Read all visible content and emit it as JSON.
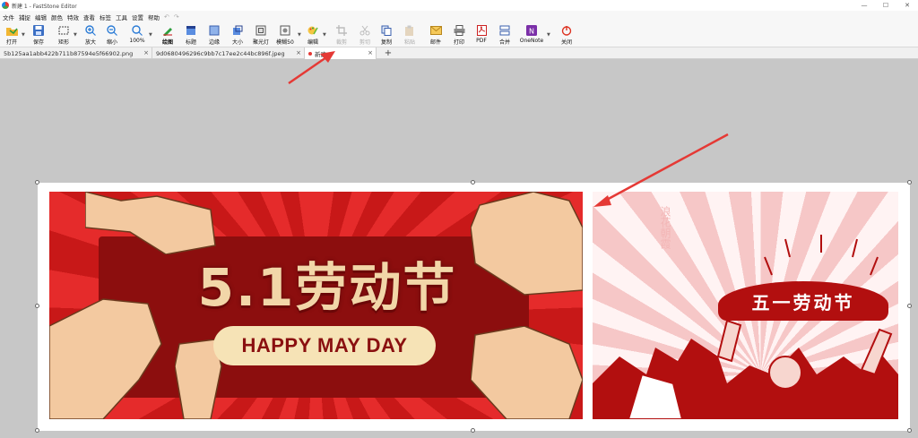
{
  "window": {
    "title": "新建 1 - FastStone Editor"
  },
  "menu": [
    "文件",
    "捕捉",
    "编辑",
    "颜色",
    "特效",
    "查看",
    "标签",
    "工具",
    "设置",
    "帮助"
  ],
  "toolbar": {
    "open": "打开",
    "save": "保存",
    "rect": "矩形",
    "zoom_in": "放大",
    "zoom_out": "缩小",
    "zoom_level": "100%",
    "draw": "绘图",
    "caption": "标题",
    "border": "边缘",
    "resize": "大小",
    "spotlight": "聚光灯",
    "blur": "模糊50",
    "edit": "编辑",
    "crop": "裁剪",
    "cut": "剪切",
    "copy": "复制",
    "paste": "粘贴",
    "email": "邮件",
    "print": "打印",
    "pdf": "PDF",
    "merge": "合并",
    "onenote": "OneNote",
    "close": "关闭"
  },
  "tabs": [
    {
      "label": "5b125aa1abb422b711b87594e5f66902.png"
    },
    {
      "label": "9d0680496296c9bb7c17ee2c44bc896f.jpeg"
    },
    {
      "label": "新建 1"
    }
  ],
  "banner1": {
    "headline": "5.1劳动节",
    "pill": "HAPPY MAY DAY"
  },
  "banner2": {
    "ribbon": "五一劳动节",
    "vertical": "浪花朝霞"
  },
  "colors": {
    "arrow": "#e53935",
    "banner_red": "#d91f1f",
    "panel": "#8c0e0e",
    "gold": "#f2d6a8"
  }
}
